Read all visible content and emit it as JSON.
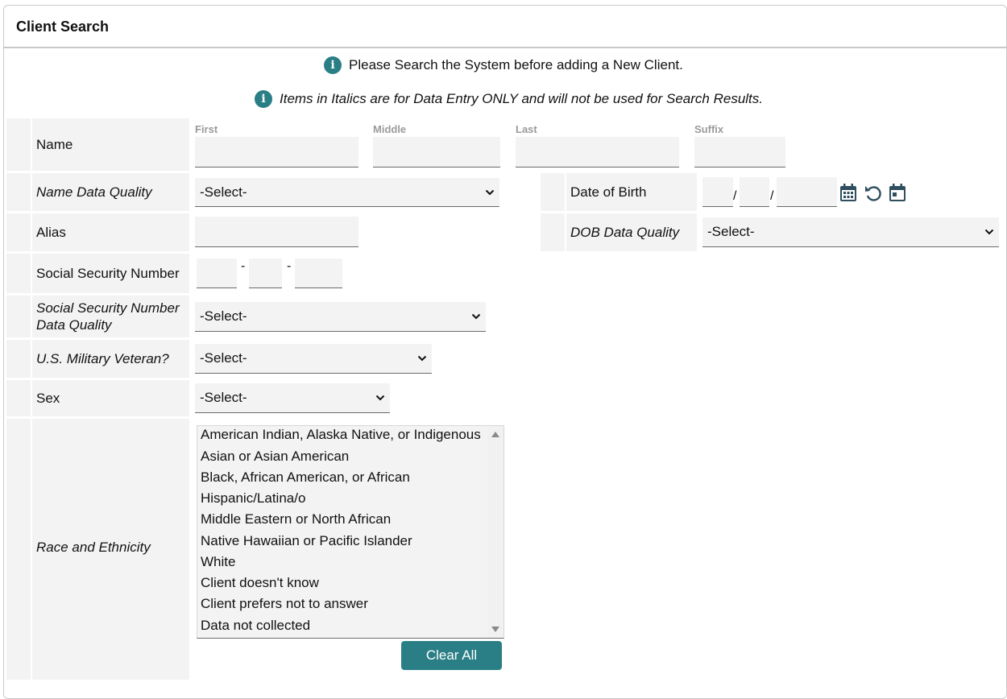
{
  "panel": {
    "title": "Client Search"
  },
  "notices": [
    "Please Search the System before adding a New Client.",
    "Items in Italics are for Data Entry ONLY and will not be used for Search Results."
  ],
  "icons": {
    "info": "info-icon",
    "calendar": "calendar-icon",
    "reset": "refresh-icon",
    "today": "calendar-today-icon"
  },
  "colors": {
    "accent": "#2a7f86",
    "field_bg": "#f3f3f3"
  },
  "fields": {
    "name": {
      "label": "Name",
      "first": "First",
      "middle": "Middle",
      "last": "Last",
      "suffix": "Suffix"
    },
    "name_quality": {
      "label": "Name Data Quality",
      "value": "-Select-"
    },
    "dob": {
      "label": "Date of Birth",
      "sep": "/"
    },
    "dob_quality": {
      "label": "DOB Data Quality",
      "value": "-Select-"
    },
    "alias": {
      "label": "Alias"
    },
    "ssn": {
      "label": "Social Security Number",
      "sep": "-"
    },
    "ssn_quality": {
      "label": "Social Security Number Data Quality",
      "value": "-Select-"
    },
    "veteran": {
      "label": "U.S. Military Veteran?",
      "value": "-Select-"
    },
    "sex": {
      "label": "Sex",
      "value": "-Select-"
    },
    "race": {
      "label": "Race and Ethnicity",
      "options": [
        "American Indian, Alaska Native, or Indigenous",
        "Asian or Asian American",
        "Black, African American, or African",
        "Hispanic/Latina/o",
        "Middle Eastern or North African",
        "Native Hawaiian or Pacific Islander",
        "White",
        "Client doesn't know",
        "Client prefers not to answer",
        "Data not collected"
      ],
      "clear_label": "Clear All"
    }
  }
}
